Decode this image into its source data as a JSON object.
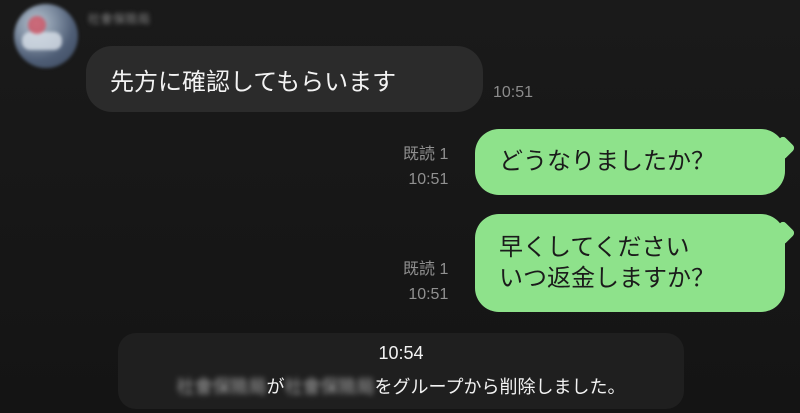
{
  "incoming": {
    "sender_name": "社會保險局",
    "message": "先方に確認してもらいます",
    "time": "10:51"
  },
  "outgoing": [
    {
      "read_status": "既読 1",
      "time": "10:51",
      "message": "どうなりましたか？"
    },
    {
      "read_status": "既読 1",
      "time": "10:51",
      "message": "早くしてください\nいつ返金しますか？"
    }
  ],
  "system": {
    "time": "10:54",
    "actor": "社會保險局",
    "connector": "が",
    "target": "社會保險局",
    "suffix": "をグループから削除しました。"
  },
  "colors": {
    "background": "#161616",
    "incoming_bubble": "#2b2b2b",
    "outgoing_bubble": "#8ee28b",
    "notice_bg": "#1f1f1f"
  }
}
